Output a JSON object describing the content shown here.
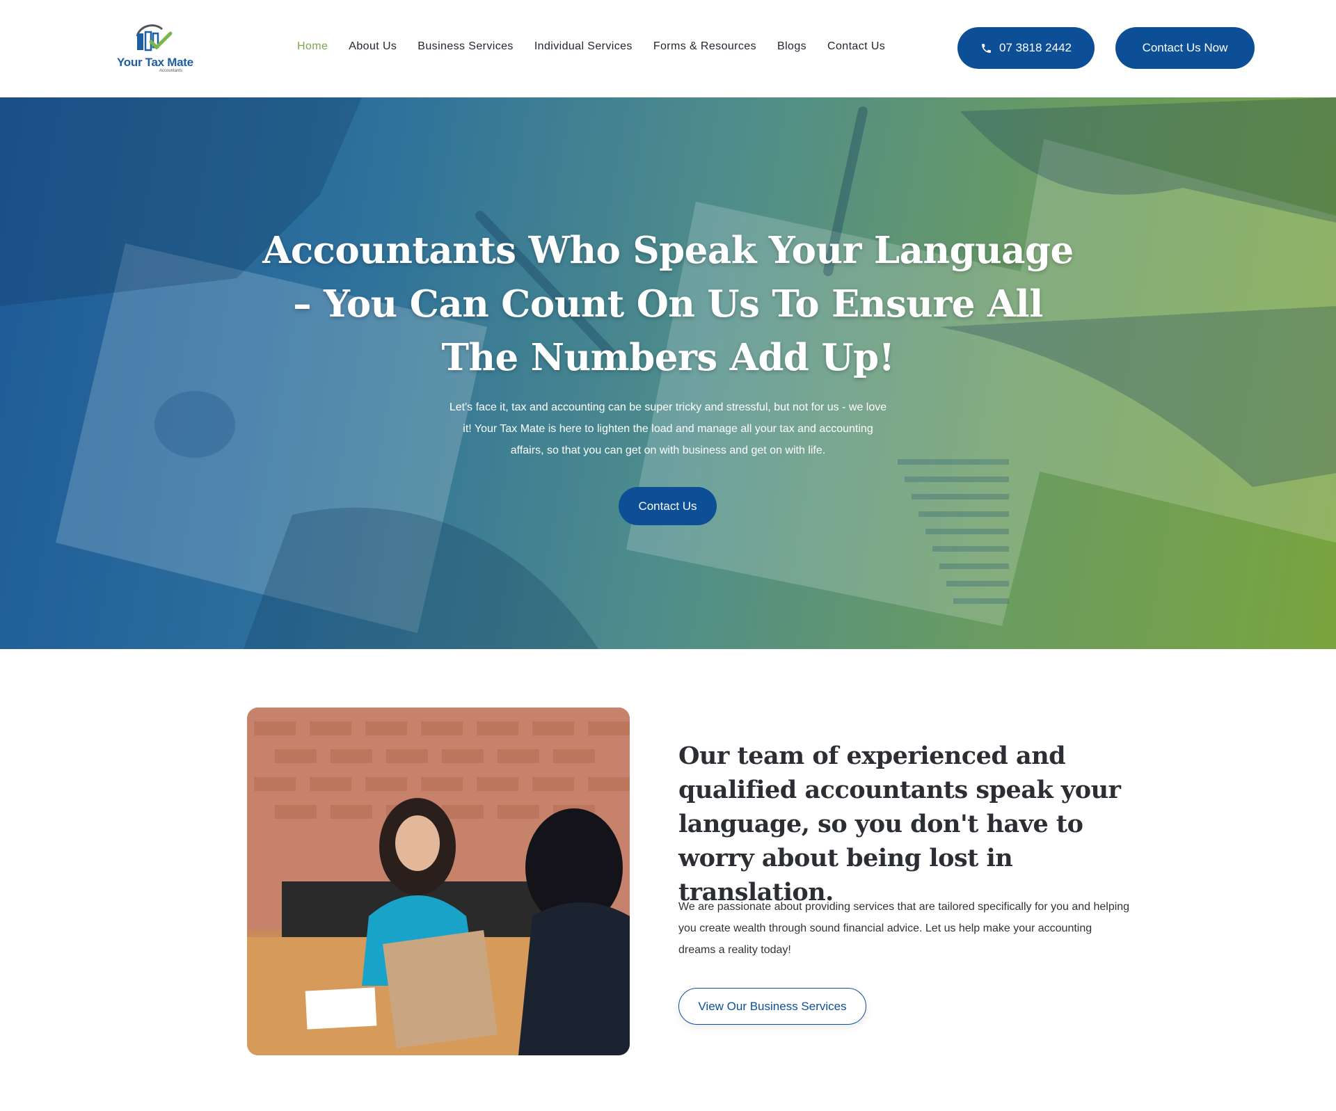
{
  "brand": {
    "name": "Your Tax Mate",
    "sub": "Accountants"
  },
  "nav": {
    "items": [
      {
        "label": "Home",
        "active": true
      },
      {
        "label": "About Us"
      },
      {
        "label": "Business Services"
      },
      {
        "label": "Individual Services"
      },
      {
        "label": "Forms & Resources"
      },
      {
        "label": "Blogs"
      },
      {
        "label": "Contact Us"
      }
    ],
    "phone_label": "07 3818 2442",
    "cta_label": "Contact Us Now"
  },
  "hero": {
    "title": "Accountants Who Speak Your Language – You Can Count On Us To Ensure All The Numbers Add Up!",
    "text": "Let's face it, tax and accounting can be super tricky and stressful, but not for us - we love it! Your Tax Mate is here to lighten the load and manage all your tax and accounting affairs, so that you can get on with business and get on with life.",
    "button_label": "Contact Us"
  },
  "intro": {
    "heading": "Our team of experienced and qualified accountants speak your language, so you don't have to worry about being lost in translation.",
    "text": "We are passionate about providing services that are tailored specifically for you and helping you create wealth through sound financial advice. Let us help make your accounting dreams a reality today!",
    "button_label": "View Our Business Services"
  },
  "colors": {
    "primary": "#0d4f96",
    "accent_green": "#7aa84a",
    "hero_gradient_start": "#1e5a97",
    "hero_gradient_end": "#7aa43e"
  },
  "icons": {
    "phone": "phone-icon",
    "logo": "logo-mark-icon"
  }
}
